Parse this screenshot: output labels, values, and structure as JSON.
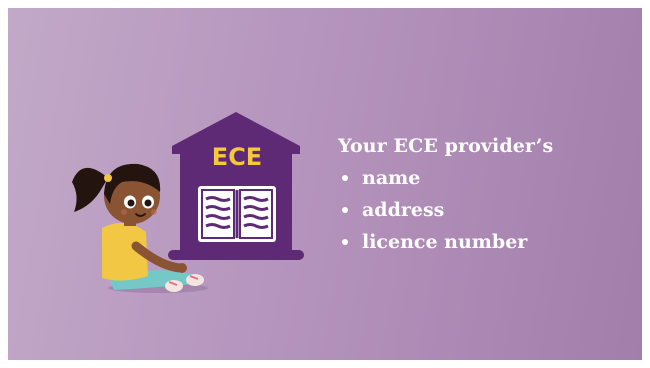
{
  "house": {
    "sign_text": "ECE"
  },
  "info": {
    "heading": "Your ECE provider’s",
    "items": [
      {
        "label": "name"
      },
      {
        "label": "address"
      },
      {
        "label": "licence number"
      }
    ]
  },
  "colors": {
    "background_left": "#c2a9c8",
    "background_right": "#a27fab",
    "house_purple": "#5e2a76",
    "sign_yellow": "#f6c83b",
    "shirt_yellow": "#f2c744",
    "pants_teal": "#74c9c7"
  },
  "icons": {
    "building": "house-icon",
    "book": "open-book-icon"
  }
}
